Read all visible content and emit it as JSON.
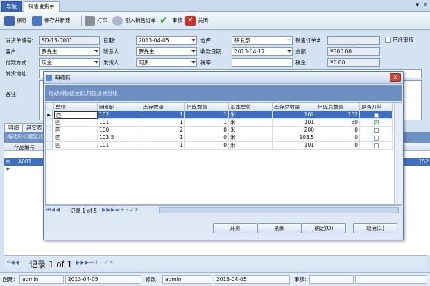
{
  "tabs": [
    {
      "label": "导航"
    },
    {
      "label": "销售发货单",
      "close": "x"
    }
  ],
  "window_controls": {
    "pin": "▾",
    "close": "x"
  },
  "toolbar": {
    "save": "保存",
    "save_new": "保存并新建",
    "print": "打印",
    "import_order": "引入销售订单",
    "audit": "审核",
    "close": "关闭"
  },
  "form": {
    "doc_no_label": "发货单编号:",
    "doc_no": "SD-13-0001",
    "date_label": "日期:",
    "date": "2013-04-05",
    "warehouse_label": "仓库:",
    "warehouse": "研发部",
    "sales_order_label": "销售订单#",
    "sales_order": "",
    "audited_label": "已经审核",
    "customer_label": "客户:",
    "customer": "罗先生",
    "contact_label": "联系人:",
    "contact": "罗先生",
    "receive_date_label": "收款日期:",
    "receive_date": "2013-04-17",
    "amount_label": "金额:",
    "amount": "¥300.00",
    "payment_label": "付款方式:",
    "payment": "现金",
    "shipper_label": "发货人:",
    "shipper": "阿贵",
    "tax_rate_label": "税率:",
    "tax_rate": "",
    "tax_label": "税金:",
    "tax": "¥0.00",
    "address_label": "发货地址:",
    "remark_label": "备注:"
  },
  "subtabs": [
    "明细",
    "其它表"
  ],
  "group_hint": "拖动列标题至此,根据该列分组",
  "main_grid": {
    "header": "存品编号",
    "rows": [
      {
        "code": "A001",
        "right_value": "152"
      }
    ]
  },
  "main_pager": {
    "record_text": "记录 1 of 1"
  },
  "status": {
    "created_label": "创建:",
    "created_by": "admin",
    "created_date": "2013-04-05",
    "modified_label": "修改:",
    "modified_by": "admin",
    "modified_date": "2013-04-05",
    "audit_label": "审核:",
    "audit_by": "",
    "audit_date": ""
  },
  "dialog": {
    "title": "明细码",
    "close": "x",
    "group_hint": "拖动列标题至此,根据该列分组",
    "columns": [
      "单位",
      "明细码",
      "库存数量",
      "出库数量",
      "基本单位",
      "库存总数量",
      "出库总数量",
      "是否开剪"
    ],
    "rows": [
      {
        "unit": "匹",
        "code": "102",
        "stock": "1",
        "out": "1",
        "base_unit": "米",
        "stock_total": "102",
        "out_total": "102",
        "cut": false
      },
      {
        "unit": "匹",
        "code": "101",
        "stock": "1",
        "out": "1",
        "base_unit": "米",
        "stock_total": "101",
        "out_total": "50",
        "cut": true
      },
      {
        "unit": "匹",
        "code": "100",
        "stock": "2",
        "out": "0",
        "base_unit": "米",
        "stock_total": "200",
        "out_total": "0",
        "cut": false
      },
      {
        "unit": "匹",
        "code": "103.5",
        "stock": "1",
        "out": "0",
        "base_unit": "米",
        "stock_total": "103.5",
        "out_total": "0",
        "cut": false
      },
      {
        "unit": "匹",
        "code": "101",
        "stock": "1",
        "out": "0",
        "base_unit": "米",
        "stock_total": "101",
        "out_total": "0",
        "cut": false
      }
    ],
    "pager_text": "记录 1 of 5",
    "buttons": {
      "cut": "开剪",
      "refresh": "刷新",
      "ok": "确定(O)",
      "cancel": "取消(C)"
    }
  },
  "colors": {
    "accent": "#3d6fc0",
    "group_band": "#6e8fc2",
    "background": "#d5e2f2"
  },
  "icons": [
    "save-icon",
    "save-new-icon",
    "print-icon",
    "import-icon",
    "audit-check-icon",
    "close-x-icon"
  ]
}
